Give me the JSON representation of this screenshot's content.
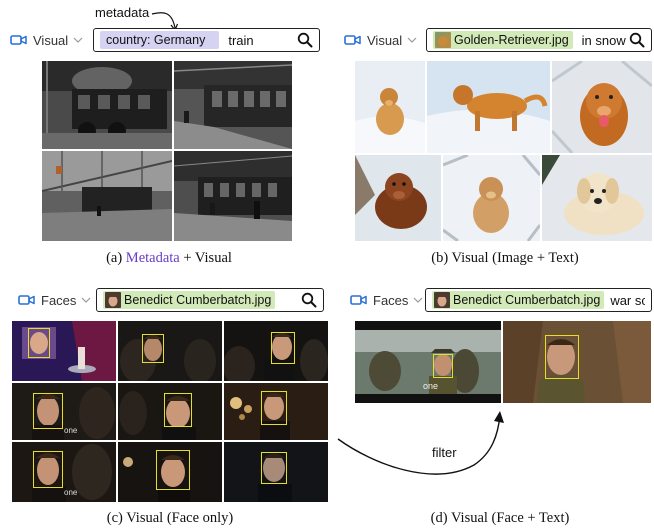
{
  "annotation": {
    "metadata_label": "metadata",
    "filter_label": "filter"
  },
  "panel_a": {
    "mode": "Visual",
    "metadata_chip": "country: Germany",
    "query_text": "train",
    "caption_prefix": "(a)",
    "caption_meta": "Metadata",
    "caption_suffix": "+ Visual"
  },
  "panel_b": {
    "mode": "Visual",
    "image_chip": "Golden-Retriever.jpg",
    "query_text": "in snow",
    "caption": "(b) Visual (Image + Text)"
  },
  "panel_c": {
    "mode": "Faces",
    "image_chip": "Benedict Cumberbatch.jpg",
    "query_text": "",
    "caption": "(c) Visual (Face only)",
    "watermark": "one"
  },
  "panel_d": {
    "mode": "Faces",
    "image_chip": "Benedict Cumberbatch.jpg",
    "query_text": "war scene",
    "caption": "(d) Visual (Face + Text)",
    "watermark": "one"
  },
  "colors": {
    "metadata_purple": "#6a3bc7",
    "metadata_chip_bg": "#d6d3f2",
    "image_chip_bg": "#d2eab8",
    "face_box": "#e6dc2a",
    "camera_icon": "#2a6fd6"
  },
  "icons": [
    "video-camera-icon",
    "chevron-down-icon",
    "search-icon",
    "curved-arrow-icon"
  ]
}
